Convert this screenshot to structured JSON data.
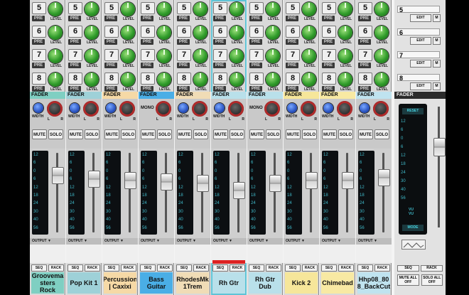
{
  "send_numbers": [
    "5",
    "6",
    "7",
    "8"
  ],
  "send_pre_label": "PRE",
  "send_level_label": "LEVEL",
  "fader_header": "FADER",
  "width_label": "WIDTH",
  "mono_label": "MONO",
  "pan_l": "L",
  "pan_r": "R",
  "mute_label": "MUTE",
  "solo_label": "SOLO",
  "meter_scale": [
    "12",
    "6",
    "0",
    "6",
    "12",
    "18",
    "24",
    "30",
    "40",
    "56"
  ],
  "output_label": "OUTPUT",
  "seq_label": "SEQ",
  "rack_label": "RACK",
  "strips": [
    {
      "name": "Groovema sters Rock",
      "color": "#7fcfc2",
      "fader": 0.78,
      "width_type": "width"
    },
    {
      "name": "Pop Kit 1",
      "color": "#9ed1d8",
      "fader": 0.72,
      "width_type": "width"
    },
    {
      "name": "Percussion | Caxixi",
      "color": "#f6d9a6",
      "fader": 0.7,
      "width_type": "width"
    },
    {
      "name": "Bass Guitar",
      "color": "#4aaee6",
      "fader": 0.68,
      "width_type": "mono"
    },
    {
      "name": "RhodesMk 1Trem",
      "color": "#f0dcb6",
      "fader": 0.66,
      "width_type": "width"
    },
    {
      "name": "Rh Gtr",
      "color": "#b9e0ea",
      "fader": 0.55,
      "width_type": "width",
      "selected": true
    },
    {
      "name": "Rh Gtr Dub",
      "color": "#b9e0ea",
      "fader": 0.66,
      "width_type": "mono"
    },
    {
      "name": "Kick 2",
      "color": "#f6e69a",
      "fader": 0.7,
      "width_type": "width"
    },
    {
      "name": "Chimebad",
      "color": "#f8e9a3",
      "fader": 0.7,
      "width_type": "width"
    },
    {
      "name": "Hhp08_80 8_BackCut",
      "color": "#bfe3ef",
      "fader": 0.74,
      "width_type": "width"
    }
  ],
  "fx": {
    "rows": [
      "5",
      "6",
      "7",
      "8"
    ],
    "edit_label": "EDIT",
    "m_label": "M"
  },
  "master": {
    "header": "FADER",
    "reset_label": "RESET",
    "vu_label": "VU\nVU",
    "mode_label": "MODE",
    "seq_label": "SEQ",
    "rack_label": "RACK",
    "mute_all_label": "MUTE ALL OFF",
    "solo_all_label": "SOLO ALL OFF",
    "meter_scale": [
      "12",
      "6",
      "0",
      "6",
      "12",
      "18",
      "24",
      "30",
      "40",
      "56"
    ],
    "fader": 0.66
  }
}
